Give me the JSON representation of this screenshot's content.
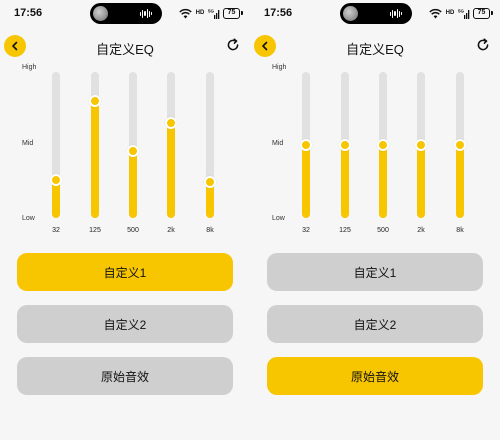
{
  "theme": {
    "accent": "#f7c600",
    "inactive_button": "#cfcfcf",
    "track": "#e1e1e1",
    "background": "#f6f6f6"
  },
  "screens": [
    {
      "status": {
        "time": "17:56",
        "hd_label": "HD",
        "signal_label": "5G",
        "battery": "75"
      },
      "header": {
        "title": "自定义EQ",
        "back_icon": "chevron-left-icon",
        "refresh_icon": "refresh-icon"
      },
      "eq": {
        "levels": {
          "high": "High",
          "mid": "Mid",
          "low": "Low"
        },
        "bands": [
          {
            "freq": "32",
            "level": 0.26
          },
          {
            "freq": "125",
            "level": 0.8
          },
          {
            "freq": "500",
            "level": 0.46
          },
          {
            "freq": "2k",
            "level": 0.65
          },
          {
            "freq": "8k",
            "level": 0.25
          }
        ]
      },
      "presets": [
        {
          "label": "自定义1",
          "active": true
        },
        {
          "label": "自定义2",
          "active": false
        },
        {
          "label": "原始音效",
          "active": false
        }
      ]
    },
    {
      "status": {
        "time": "17:56",
        "hd_label": "HD",
        "signal_label": "5G",
        "battery": "75"
      },
      "header": {
        "title": "自定义EQ",
        "back_icon": "chevron-left-icon",
        "refresh_icon": "refresh-icon"
      },
      "eq": {
        "levels": {
          "high": "High",
          "mid": "Mid",
          "low": "Low"
        },
        "bands": [
          {
            "freq": "32",
            "level": 0.5
          },
          {
            "freq": "125",
            "level": 0.5
          },
          {
            "freq": "500",
            "level": 0.5
          },
          {
            "freq": "2k",
            "level": 0.5
          },
          {
            "freq": "8k",
            "level": 0.5
          }
        ]
      },
      "presets": [
        {
          "label": "自定义1",
          "active": false
        },
        {
          "label": "自定义2",
          "active": false
        },
        {
          "label": "原始音效",
          "active": true
        }
      ]
    }
  ]
}
